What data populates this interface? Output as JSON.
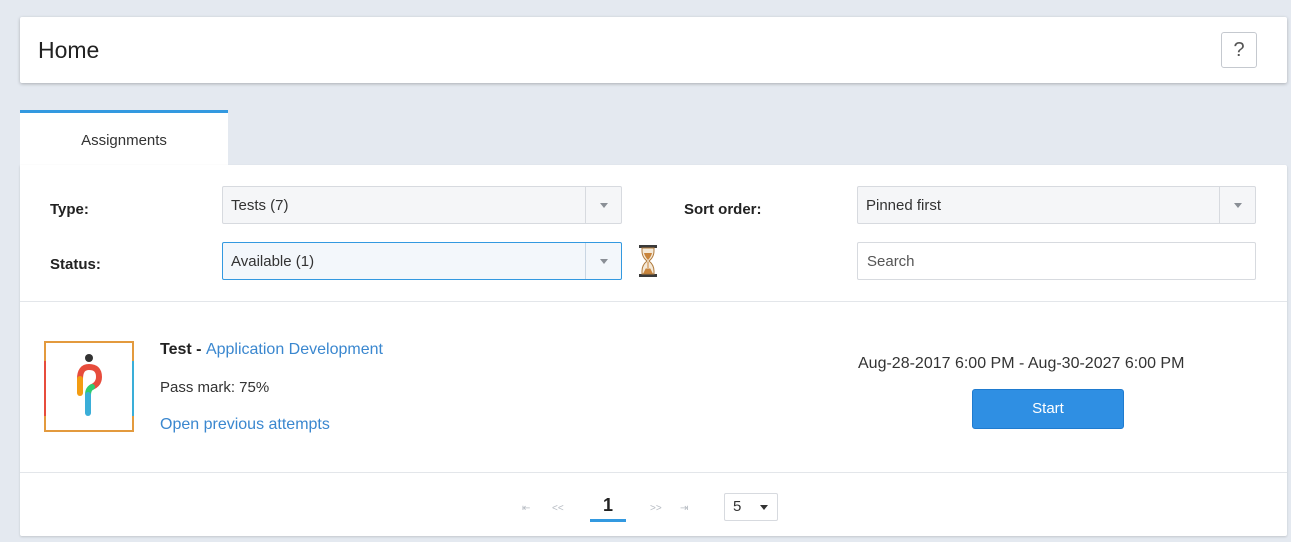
{
  "header": {
    "title": "Home",
    "help_label": "?"
  },
  "tabs": [
    {
      "label": "Assignments",
      "active": true
    }
  ],
  "filters": {
    "type_label": "Type:",
    "type_value": "Tests (7)",
    "status_label": "Status:",
    "status_value": "Available (1)",
    "sort_label": "Sort order:",
    "sort_value": "Pinned first",
    "search_placeholder": "Search"
  },
  "assignment": {
    "name": "Test",
    "separator": " - ",
    "course": "Application Development",
    "pass_mark": "Pass mark: 75%",
    "previous_attempts_link": "Open previous attempts",
    "date_range": "Aug-28-2017 6:00 PM - Aug-30-2027 6:00 PM",
    "start_label": "Start"
  },
  "pagination": {
    "first_icon": "⇤",
    "prev_icon": "<<",
    "current_page": "1",
    "next_icon": ">>",
    "last_icon": "⇥",
    "page_size": "5"
  },
  "colors": {
    "accent": "#3399e0",
    "link": "#3a87cf",
    "button": "#2f8fe3",
    "background": "#e4e9f0"
  },
  "icons": [
    "help-icon",
    "chevron-down-icon",
    "hourglass-icon",
    "app-logo-icon",
    "pager-first-icon",
    "pager-prev-icon",
    "pager-next-icon",
    "pager-last-icon"
  ]
}
